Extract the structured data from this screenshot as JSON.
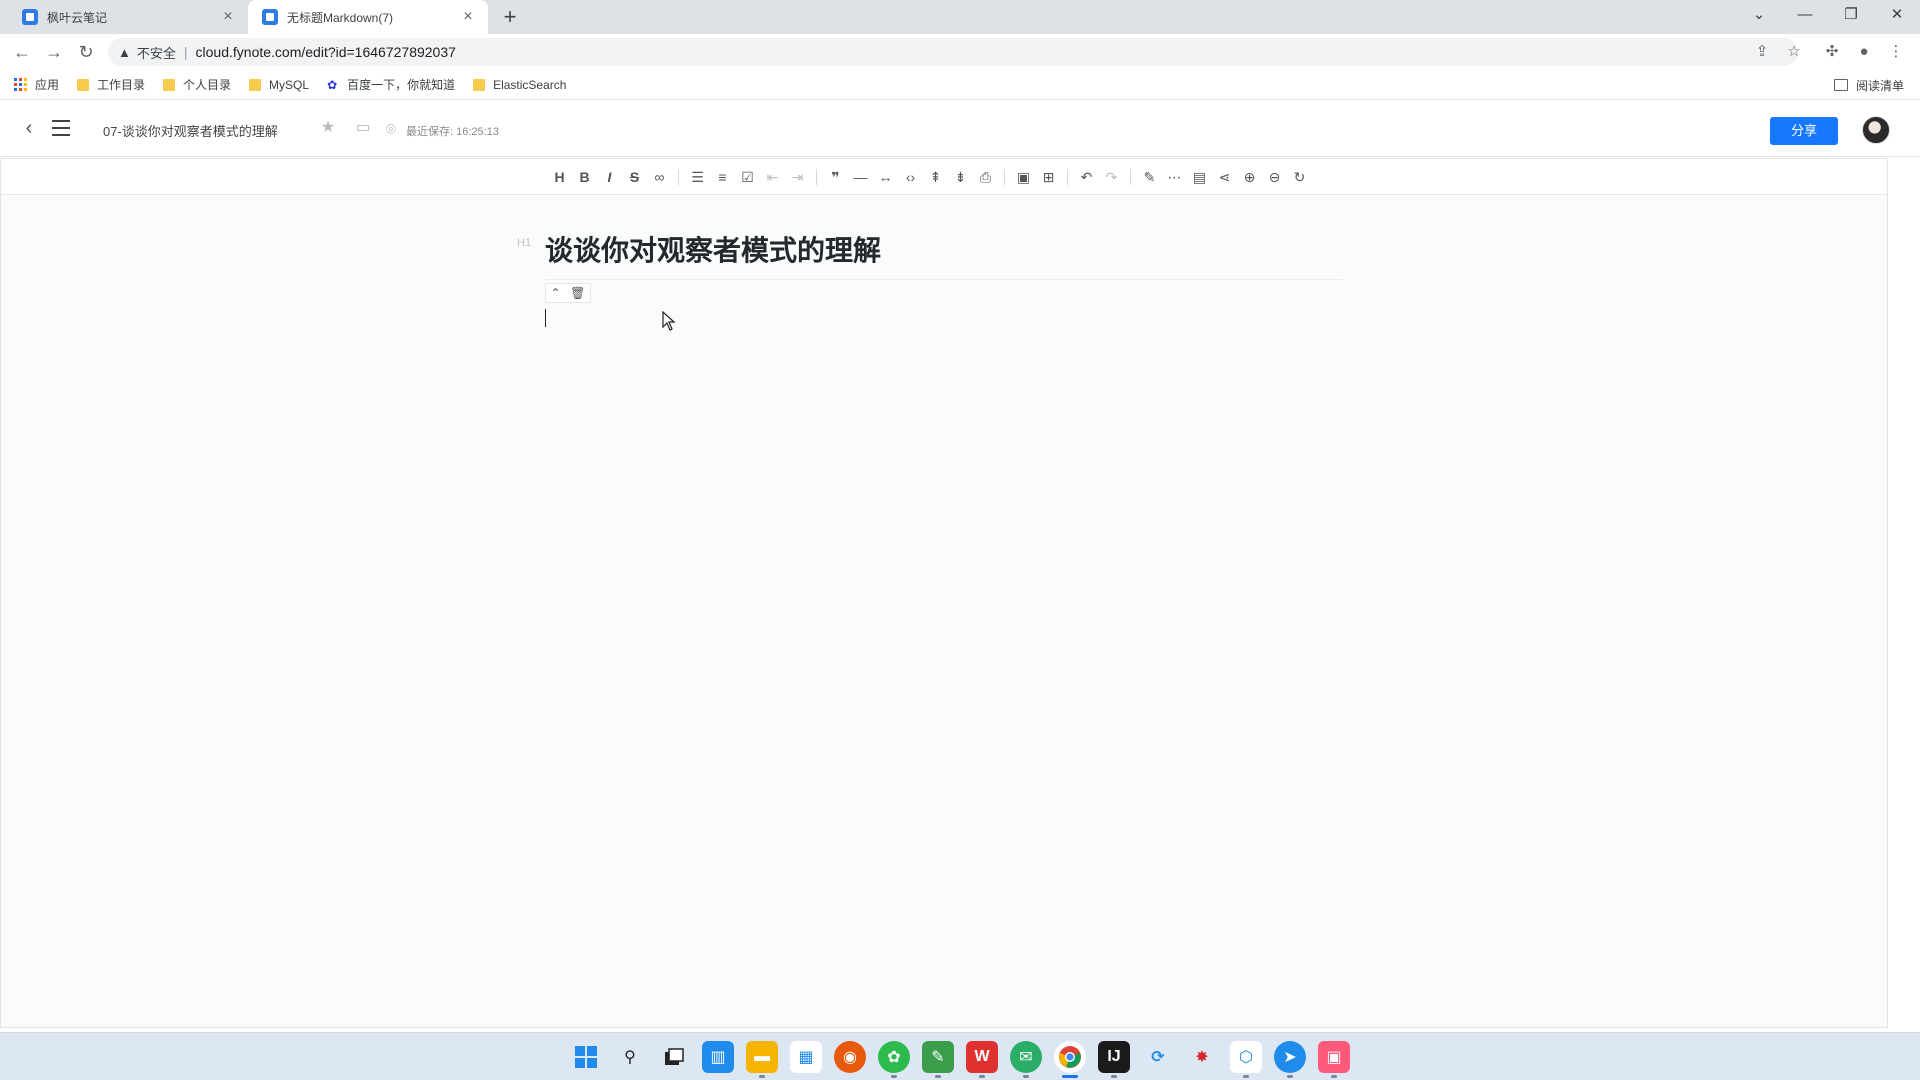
{
  "browser": {
    "tabs": [
      {
        "title": "枫叶云笔记",
        "active": false
      },
      {
        "title": "无标题Markdown(7)",
        "active": true
      }
    ],
    "new_tab_label": "+",
    "window_controls": {
      "dropdown": "⌄",
      "minimize": "—",
      "restore": "❐",
      "close": "✕"
    },
    "security_label": "不安全",
    "url": "cloud.fynote.com/edit?id=1646727892037",
    "bookmarks": [
      {
        "label": "应用",
        "icon": "apps-grid-icon"
      },
      {
        "label": "工作目录",
        "icon": "folder-icon"
      },
      {
        "label": "个人目录",
        "icon": "folder-icon"
      },
      {
        "label": "MySQL",
        "icon": "folder-icon"
      },
      {
        "label": "百度一下，你就知道",
        "icon": "baidu-paw-icon"
      },
      {
        "label": "ElasticSearch",
        "icon": "folder-icon"
      }
    ],
    "reading_list_label": "阅读清单"
  },
  "app": {
    "doc_title": "07-谈谈你对观察者模式的理解",
    "saved_status": "最近保存: 16:25:13",
    "share_label": "分享",
    "accent_color": "#1677ff"
  },
  "editor": {
    "heading_tag": "H1",
    "heading_text": "谈谈你对观察者模式的理解"
  }
}
